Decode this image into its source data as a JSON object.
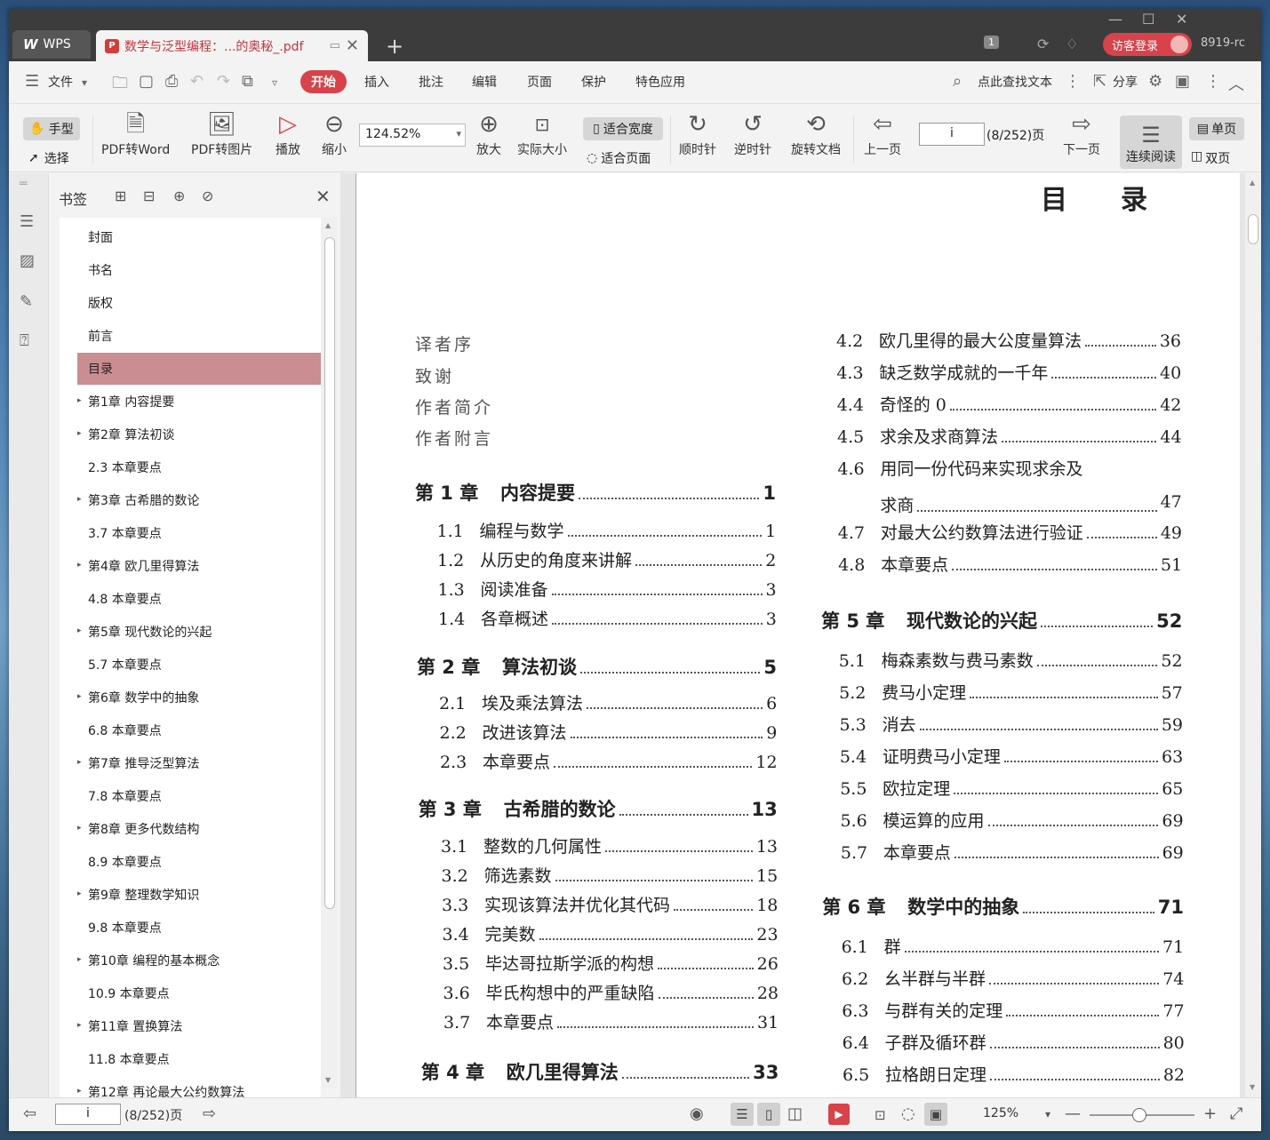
{
  "titlebar": {
    "app_label": "WPS",
    "tab_title": "数学与泛型编程：...的奥秘_.pdf",
    "badge": "1",
    "login_label": "访客登录",
    "user_id": "8919-rc"
  },
  "menubar": {
    "file": "文件",
    "start": "开始",
    "items": [
      "插入",
      "批注",
      "编辑",
      "页面",
      "保护",
      "特色应用"
    ],
    "search": "点此查找文本",
    "share": "分享"
  },
  "toolbar": {
    "hand": "手型",
    "select": "选择",
    "pdf_to_word": "PDF转Word",
    "pdf_to_image": "PDF转图片",
    "play": "播放",
    "zoom_out": "缩小",
    "zoom_value": "124.52%",
    "zoom_in": "放大",
    "actual_size": "实际大小",
    "fit_width": "适合宽度",
    "fit_page": "适合页面",
    "clockwise": "顺时针",
    "counterclockwise": "逆时针",
    "rotate_doc": "旋转文档",
    "prev_page": "上一页",
    "page_value": "i",
    "page_total": "(8/252)页",
    "next_page": "下一页",
    "continuous": "连续阅读",
    "single_page": "单页",
    "double_page": "双页"
  },
  "bookmarks": {
    "header": "书签",
    "items": [
      {
        "label": "封面",
        "arrow": false,
        "selected": false
      },
      {
        "label": "书名",
        "arrow": false,
        "selected": false
      },
      {
        "label": "版权",
        "arrow": false,
        "selected": false
      },
      {
        "label": "前言",
        "arrow": false,
        "selected": false
      },
      {
        "label": "目录",
        "arrow": false,
        "selected": true
      },
      {
        "label": "第1章  内容提要",
        "arrow": true,
        "selected": false
      },
      {
        "label": "第2章  算法初谈",
        "arrow": true,
        "selected": false
      },
      {
        "label": "2.3  本章要点",
        "arrow": false,
        "selected": false
      },
      {
        "label": "第3章  古希腊的数论",
        "arrow": true,
        "selected": false
      },
      {
        "label": "3.7  本章要点",
        "arrow": false,
        "selected": false
      },
      {
        "label": "第4章  欧几里得算法",
        "arrow": true,
        "selected": false
      },
      {
        "label": "4.8  本章要点",
        "arrow": false,
        "selected": false
      },
      {
        "label": "第5章  现代数论的兴起",
        "arrow": true,
        "selected": false
      },
      {
        "label": "5.7  本章要点",
        "arrow": false,
        "selected": false
      },
      {
        "label": "第6章  数学中的抽象",
        "arrow": true,
        "selected": false
      },
      {
        "label": "6.8  本章要点",
        "arrow": false,
        "selected": false
      },
      {
        "label": "第7章  推导泛型算法",
        "arrow": true,
        "selected": false
      },
      {
        "label": "7.8  本章要点",
        "arrow": false,
        "selected": false
      },
      {
        "label": "第8章  更多代数结构",
        "arrow": true,
        "selected": false
      },
      {
        "label": "8.9  本章要点",
        "arrow": false,
        "selected": false
      },
      {
        "label": "第9章  整理数学知识",
        "arrow": true,
        "selected": false
      },
      {
        "label": "9.8  本章要点",
        "arrow": false,
        "selected": false
      },
      {
        "label": "第10章  编程的基本概念",
        "arrow": true,
        "selected": false
      },
      {
        "label": "10.9  本章要点",
        "arrow": false,
        "selected": false
      },
      {
        "label": "第11章  置换算法",
        "arrow": true,
        "selected": false
      },
      {
        "label": "11.8  本章要点",
        "arrow": false,
        "selected": false
      },
      {
        "label": "第12章  再论最大公约数算法",
        "arrow": true,
        "selected": false
      }
    ]
  },
  "document": {
    "title": "目录",
    "front_matter": [
      "译者序",
      "致谢",
      "作者简介",
      "作者附言"
    ],
    "left_column": [
      {
        "kind": "chap",
        "num": "第 1 章",
        "title": "内容提要",
        "page": "1"
      },
      {
        "kind": "sec",
        "num": "1.1",
        "title": "编程与数学",
        "page": "1"
      },
      {
        "kind": "sec",
        "num": "1.2",
        "title": "从历史的角度来讲解",
        "page": "2"
      },
      {
        "kind": "sec",
        "num": "1.3",
        "title": "阅读准备",
        "page": "3"
      },
      {
        "kind": "sec",
        "num": "1.4",
        "title": "各章概述",
        "page": "3"
      },
      {
        "kind": "chap",
        "num": "第 2 章",
        "title": "算法初谈",
        "page": "5"
      },
      {
        "kind": "sec",
        "num": "2.1",
        "title": "埃及乘法算法",
        "page": "6"
      },
      {
        "kind": "sec",
        "num": "2.2",
        "title": "改进该算法",
        "page": "9"
      },
      {
        "kind": "sec",
        "num": "2.3",
        "title": "本章要点",
        "page": "12"
      },
      {
        "kind": "chap",
        "num": "第 3 章",
        "title": "古希腊的数论",
        "page": "13"
      },
      {
        "kind": "sec",
        "num": "3.1",
        "title": "整数的几何属性",
        "page": "13"
      },
      {
        "kind": "sec",
        "num": "3.2",
        "title": "筛选素数",
        "page": "15"
      },
      {
        "kind": "sec",
        "num": "3.3",
        "title": "实现该算法并优化其代码",
        "page": "18"
      },
      {
        "kind": "sec",
        "num": "3.4",
        "title": "完美数",
        "page": "23"
      },
      {
        "kind": "sec",
        "num": "3.5",
        "title": "毕达哥拉斯学派的构想",
        "page": "26"
      },
      {
        "kind": "sec",
        "num": "3.6",
        "title": "毕氏构想中的严重缺陷",
        "page": "28"
      },
      {
        "kind": "sec",
        "num": "3.7",
        "title": "本章要点",
        "page": "31"
      },
      {
        "kind": "chap",
        "num": "第 4 章",
        "title": "欧几里得算法",
        "page": "33"
      }
    ],
    "right_column": [
      {
        "kind": "sec",
        "num": "4.2",
        "title": "欧几里得的最大公度量算法",
        "page": "36"
      },
      {
        "kind": "sec",
        "num": "4.3",
        "title": "缺乏数学成就的一千年",
        "page": "40"
      },
      {
        "kind": "sec",
        "num": "4.4",
        "title": "奇怪的 0",
        "page": "42"
      },
      {
        "kind": "sec",
        "num": "4.5",
        "title": "求余及求商算法",
        "page": "44"
      },
      {
        "kind": "sec2",
        "num": "4.6",
        "title": "用同一份代码来实现求余及",
        "title2": "求商",
        "page": "47"
      },
      {
        "kind": "sec",
        "num": "4.7",
        "title": "对最大公约数算法进行验证",
        "page": "49"
      },
      {
        "kind": "sec",
        "num": "4.8",
        "title": "本章要点",
        "page": "51"
      },
      {
        "kind": "chap",
        "num": "第 5 章",
        "title": "现代数论的兴起",
        "page": "52"
      },
      {
        "kind": "sec",
        "num": "5.1",
        "title": "梅森素数与费马素数",
        "page": "52"
      },
      {
        "kind": "sec",
        "num": "5.2",
        "title": "费马小定理",
        "page": "57"
      },
      {
        "kind": "sec",
        "num": "5.3",
        "title": "消去",
        "page": "59"
      },
      {
        "kind": "sec",
        "num": "5.4",
        "title": "证明费马小定理",
        "page": "63"
      },
      {
        "kind": "sec",
        "num": "5.5",
        "title": "欧拉定理",
        "page": "65"
      },
      {
        "kind": "sec",
        "num": "5.6",
        "title": "模运算的应用",
        "page": "69"
      },
      {
        "kind": "sec",
        "num": "5.7",
        "title": "本章要点",
        "page": "69"
      },
      {
        "kind": "chap",
        "num": "第 6 章",
        "title": "数学中的抽象",
        "page": "71"
      },
      {
        "kind": "sec",
        "num": "6.1",
        "title": "群",
        "page": "71"
      },
      {
        "kind": "sec",
        "num": "6.2",
        "title": "幺半群与半群",
        "page": "74"
      },
      {
        "kind": "sec",
        "num": "6.3",
        "title": "与群有关的定理",
        "page": "77"
      },
      {
        "kind": "sec",
        "num": "6.4",
        "title": "子群及循环群",
        "page": "80"
      },
      {
        "kind": "sec",
        "num": "6.5",
        "title": "拉格朗日定理",
        "page": "82"
      }
    ]
  },
  "statusbar": {
    "page_value": "i",
    "page_total": "(8/252)页",
    "zoom": "125%"
  }
}
